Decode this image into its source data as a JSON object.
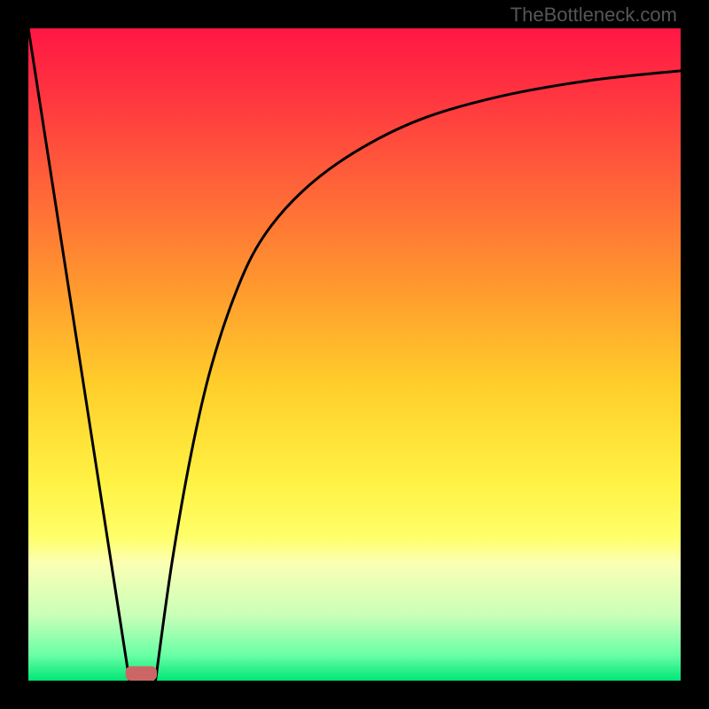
{
  "watermark": "TheBottleneck.com",
  "chart_data": {
    "type": "line",
    "title": "",
    "xlabel": "",
    "ylabel": "",
    "xlim": [
      0,
      100
    ],
    "ylim": [
      0,
      100
    ],
    "background": {
      "type": "vertical-gradient",
      "stops": [
        {
          "pos": 0.0,
          "color": "#ff1744"
        },
        {
          "pos": 0.1,
          "color": "#ff3440"
        },
        {
          "pos": 0.25,
          "color": "#ff6638"
        },
        {
          "pos": 0.4,
          "color": "#ff9a2e"
        },
        {
          "pos": 0.55,
          "color": "#ffcf2a"
        },
        {
          "pos": 0.7,
          "color": "#fff345"
        },
        {
          "pos": 0.78,
          "color": "#ffff6a"
        },
        {
          "pos": 0.82,
          "color": "#fbffb4"
        },
        {
          "pos": 0.9,
          "color": "#c9ffb8"
        },
        {
          "pos": 0.96,
          "color": "#6bffa6"
        },
        {
          "pos": 1.0,
          "color": "#00e676"
        }
      ]
    },
    "series": [
      {
        "name": "left-line",
        "type": "line",
        "x": [
          0,
          15.5
        ],
        "y": [
          100,
          0
        ],
        "note": "straight descending line from top-left edge to trough"
      },
      {
        "name": "right-curve",
        "type": "line",
        "x": [
          19.5,
          22,
          25,
          28,
          32,
          36,
          42,
          50,
          60,
          72,
          86,
          100
        ],
        "y": [
          0,
          18,
          35,
          48,
          60,
          68,
          75,
          81,
          86,
          89.5,
          92,
          93.5
        ],
        "note": "concave saturating curve rising from trough toward upper-right"
      }
    ],
    "marker": {
      "shape": "rounded-rect",
      "color": "#cc6666",
      "center_x": 17.3,
      "width": 4.8,
      "y": 0,
      "height": 2.2
    }
  },
  "dimensions": {
    "outer": 800,
    "inner": 736,
    "margin": 32
  }
}
